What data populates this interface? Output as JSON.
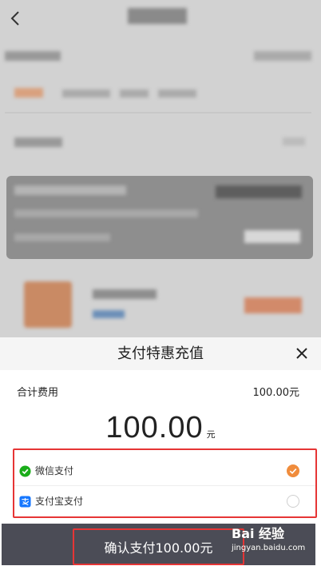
{
  "sheet": {
    "title": "支付特惠充值",
    "total_label": "合计费用",
    "total_value": "100.00元",
    "amount": "100.00",
    "amount_unit": "元",
    "methods": [
      {
        "label": "微信支付",
        "icon": "wechat-pay-icon",
        "selected": true
      },
      {
        "label": "支付宝支付",
        "icon": "alipay-icon",
        "selected": false
      }
    ],
    "confirm_label": "确认支付100.00元"
  },
  "watermark": {
    "top": "Bai 经验",
    "bottom": "jingyan.baidu.com"
  },
  "colors": {
    "accent": "#f08c3c",
    "highlight_border": "#e63535",
    "wechat_green": "#1aad19",
    "alipay_blue": "#1677ff",
    "confirm_bar": "#4b4c56"
  }
}
